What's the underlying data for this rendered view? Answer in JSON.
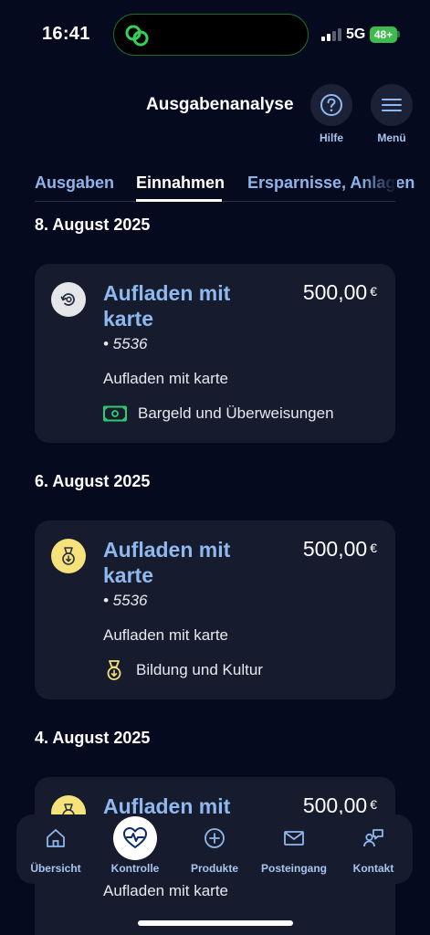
{
  "status_bar": {
    "time": "16:41",
    "network": "5G",
    "battery": "48+"
  },
  "header": {
    "title": "Ausgabenanalyse",
    "help_label": "Hilfe",
    "menu_label": "Menü"
  },
  "tabs": [
    {
      "label": "Ausgaben",
      "active": false
    },
    {
      "label": "Einnahmen",
      "active": true
    },
    {
      "label": "Ersparnisse, Anlagen",
      "active": false
    }
  ],
  "sections": [
    {
      "date": "8. August 2025",
      "transaction": {
        "title": "Aufladen mit karte",
        "amount": "500,00",
        "currency": "€",
        "card": "• 5536",
        "description": "Aufladen mit karte",
        "category": "Bargeld und Überweisungen",
        "category_icon": "cash-icon",
        "category_color": "#2ecc71"
      }
    },
    {
      "date": "6. August 2025",
      "transaction": {
        "title": "Aufladen mit karte",
        "amount": "500,00",
        "currency": "€",
        "card": "• 5536",
        "description": "Aufladen mit karte",
        "category": "Bildung und Kultur",
        "category_icon": "medal-icon",
        "category_color": "#f5e27a"
      }
    },
    {
      "date": "4. August 2025",
      "transaction": {
        "title": "Aufladen mit",
        "amount": "500,00",
        "currency": "€",
        "description": "Aufladen mit karte"
      }
    }
  ],
  "bottom_nav": [
    {
      "label": "Übersicht",
      "icon": "home-icon"
    },
    {
      "label": "Kontrolle",
      "icon": "heart-pulse-icon",
      "active": true
    },
    {
      "label": "Produkte",
      "icon": "plus-circle-icon"
    },
    {
      "label": "Posteingang",
      "icon": "mail-icon"
    },
    {
      "label": "Kontakt",
      "icon": "contact-icon"
    }
  ]
}
